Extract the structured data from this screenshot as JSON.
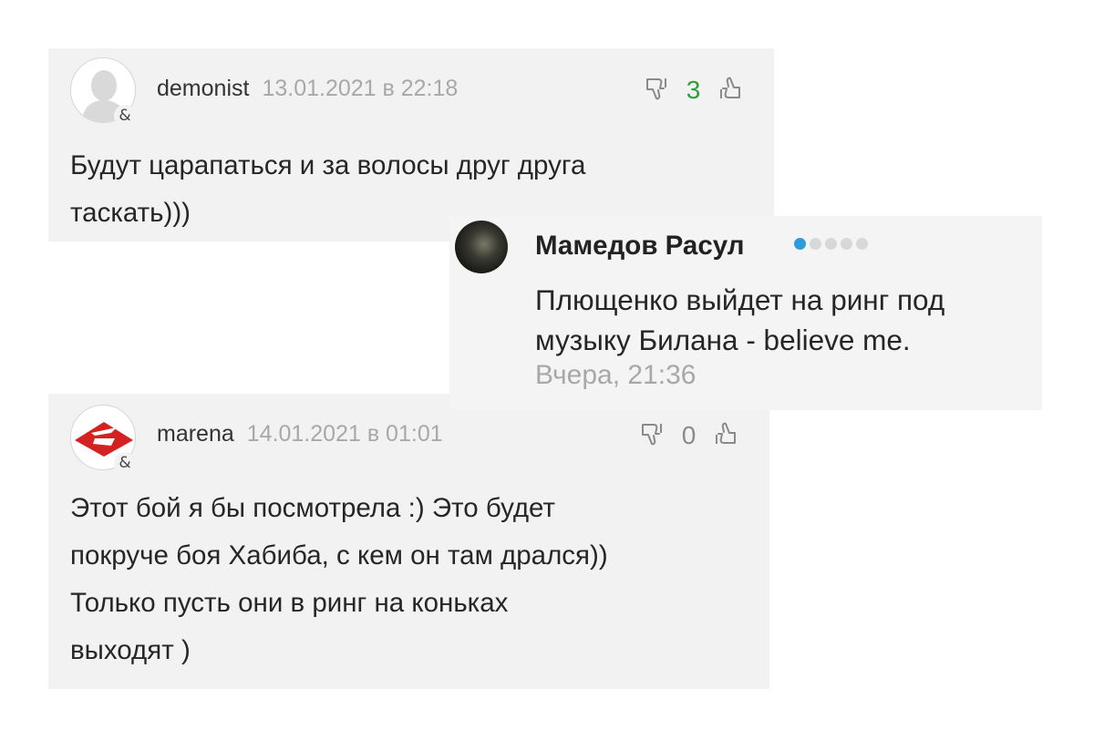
{
  "comments": [
    {
      "username": "demonist",
      "date": "13.01.2021 в 22:18",
      "vote_count": "3",
      "vote_color": "#2e9e3a",
      "avatar_badge": "&",
      "avatar_icon": "default-user-icon",
      "text_lines": [
        "Будут царапаться и за волосы друг друга",
        "таскать)))"
      ]
    },
    {
      "username": "marena",
      "date": "14.01.2021 в 01:01",
      "vote_count": "0",
      "vote_color": "#8a8a8a",
      "avatar_badge": "&",
      "avatar_icon": "spartak-logo-icon",
      "text_lines": [
        "Этот бой я бы посмотрела :) Это будет",
        "покруче боя Хабиба, с кем он там дрался))",
        "Только пусть они в ринг на коньках",
        "выходят )"
      ]
    }
  ],
  "reply": {
    "author": "Мамедов Расул",
    "rating_dots_total": 5,
    "rating_dots_active": 1,
    "active_dot_color": "#2d9cdb",
    "text_lines": [
      "Плющенко выйдет на ринг под",
      "музыку Билана - believe me."
    ],
    "time": "Вчера, 21:36"
  }
}
